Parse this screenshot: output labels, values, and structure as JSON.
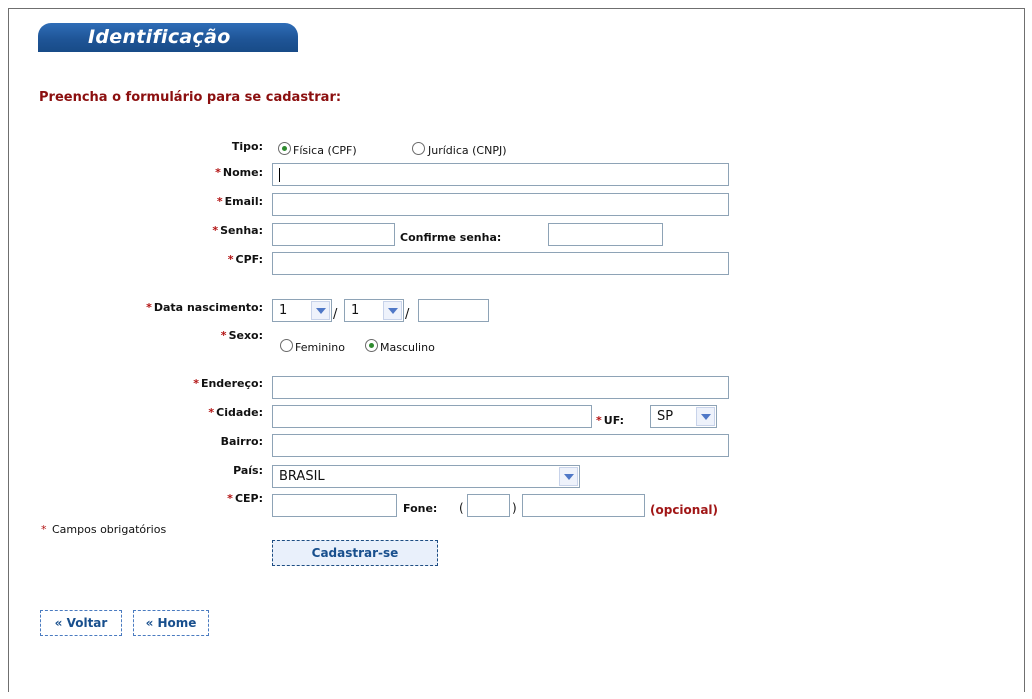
{
  "header": {
    "title": "Identificação"
  },
  "intro": "Preencha o formulário para se cadastrar:",
  "required_marker": "*",
  "fields": {
    "tipo": {
      "label": "Tipo:",
      "option1": "Física (CPF)",
      "option2": "Jurídica (CNPJ)",
      "selected": "Física (CPF)"
    },
    "nome": {
      "label": "Nome:",
      "value": ""
    },
    "email": {
      "label": "Email:",
      "value": ""
    },
    "senha": {
      "label": "Senha:",
      "value": "",
      "confirm_label": "Confirme senha:",
      "confirm_value": ""
    },
    "cpf": {
      "label": "CPF:",
      "value": ""
    },
    "data_nascimento": {
      "label": "Data nascimento:",
      "day": "1",
      "month": "1",
      "year": "",
      "separator": "/"
    },
    "sexo": {
      "label": "Sexo:",
      "option1": "Feminino",
      "option2": "Masculino",
      "selected": "Masculino"
    },
    "endereco": {
      "label": "Endereço:",
      "value": ""
    },
    "cidade": {
      "label": "Cidade:",
      "value": ""
    },
    "uf": {
      "label": "UF:",
      "value": "SP"
    },
    "bairro": {
      "label": "Bairro:",
      "value": ""
    },
    "pais": {
      "label": "País:",
      "value": "BRASIL"
    },
    "cep": {
      "label": "CEP:",
      "value": ""
    },
    "fone": {
      "label": "Fone:",
      "open_paren": "(",
      "close_paren": ")",
      "ddd": "",
      "number": "",
      "optional": "(opcional)"
    }
  },
  "required_note": "Campos obrigatórios",
  "buttons": {
    "submit": "Cadastrar-se",
    "back": "« Voltar",
    "home": "« Home"
  },
  "colors": {
    "header_blue": "#1f5597",
    "intro_red": "#8b0f0f",
    "required_red": "#b21212",
    "optional_red": "#a11717",
    "button_blue": "#184f8d"
  }
}
